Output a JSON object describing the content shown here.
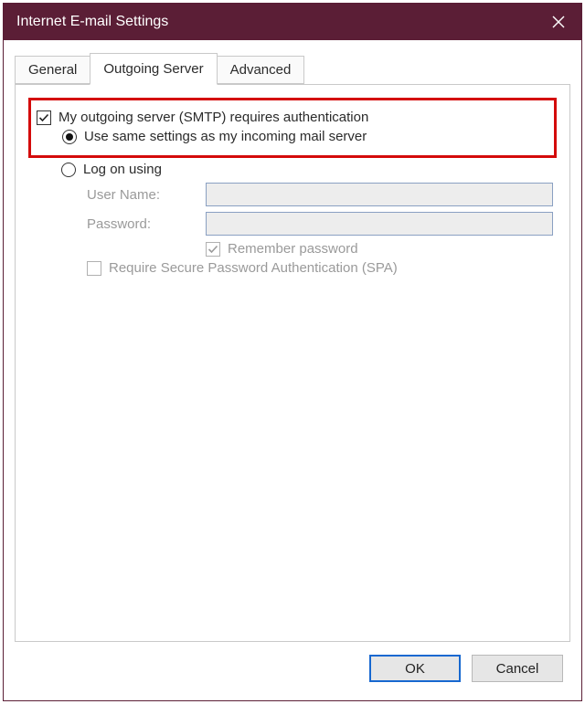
{
  "window": {
    "title": "Internet E-mail Settings"
  },
  "tabs": {
    "general": "General",
    "outgoing": "Outgoing Server",
    "advanced": "Advanced"
  },
  "form": {
    "requires_auth_label": "My outgoing server (SMTP) requires authentication",
    "use_same_label": "Use same settings as my incoming mail server",
    "log_on_label": "Log on using",
    "user_name_label": "User Name:",
    "password_label": "Password:",
    "remember_password_label": "Remember password",
    "require_spa_label": "Require Secure Password Authentication (SPA)",
    "user_name_value": "",
    "password_value": ""
  },
  "buttons": {
    "ok": "OK",
    "cancel": "Cancel"
  }
}
